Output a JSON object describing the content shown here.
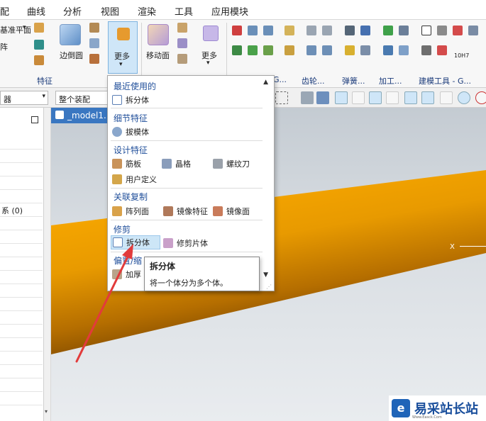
{
  "menubar": {
    "items": [
      "配",
      "曲线",
      "分析",
      "视图",
      "渲染",
      "工具",
      "应用模块"
    ]
  },
  "ribbon": {
    "left_labels": [
      "基准平面",
      "阵"
    ],
    "edge_blend_label": "边倒圆",
    "more_label": "更多",
    "move_face_label": "移动面",
    "more_label_2": "更多",
    "group_feature": "特征",
    "groups_right": [
      "G...",
      "齿轮...",
      "弹簧...",
      "加工...",
      "建模工具 - G..."
    ],
    "gear_tag": "10H7"
  },
  "toolbar2": {
    "filter_value": "器",
    "assembly_value": "整个装配"
  },
  "navpanel": {
    "rows": [
      "",
      "",
      "",
      "",
      "",
      "系 (0)",
      "",
      "",
      "",
      "",
      "",
      "",
      "",
      "",
      "",
      "",
      "",
      "",
      "",
      ""
    ]
  },
  "viewport": {
    "tab_title": "_model1.",
    "axis_label": "X"
  },
  "dropdown": {
    "recent_header": "最近使用的",
    "recent_items": [
      {
        "label": "拆分体",
        "icon": "split-body-icon"
      }
    ],
    "detail_header": "细节特征",
    "detail_items": [
      {
        "label": "拔模体",
        "icon": "draft-body-icon"
      }
    ],
    "design_header": "设计特征",
    "design_items": [
      {
        "label": "筋板",
        "icon": "rib-icon"
      },
      {
        "label": "晶格",
        "icon": "lattice-icon"
      },
      {
        "label": "螺纹刀",
        "icon": "thread-tool-icon"
      },
      {
        "label": "用户定义",
        "icon": "user-defined-icon"
      }
    ],
    "assoc_header": "关联复制",
    "assoc_items": [
      {
        "label": "阵列面",
        "icon": "pattern-face-icon"
      },
      {
        "label": "镜像特征",
        "icon": "mirror-feature-icon"
      },
      {
        "label": "镜像面",
        "icon": "mirror-face-icon"
      }
    ],
    "trim_header": "修剪",
    "trim_items": [
      {
        "label": "拆分体",
        "icon": "split-body-icon"
      },
      {
        "label": "修剪片体",
        "icon": "trim-sheet-icon"
      }
    ],
    "offset_header": "偏置/缩",
    "offset_items": [
      {
        "label": "加厚",
        "icon": "thicken-icon"
      },
      {
        "label": "体",
        "icon": "body-icon"
      }
    ]
  },
  "tooltip": {
    "title": "拆分体",
    "description": "将一个体分为多个体。"
  },
  "watermark": {
    "text": "易采站长站",
    "url": "Www.Easck.Com"
  },
  "colors": {
    "accent_blue": "#3a77c1",
    "header_blue": "#1f4e9a",
    "highlight": "#cde6f7",
    "cylinder_orange": "#f5a500",
    "arrow_red": "#e23b3b"
  }
}
